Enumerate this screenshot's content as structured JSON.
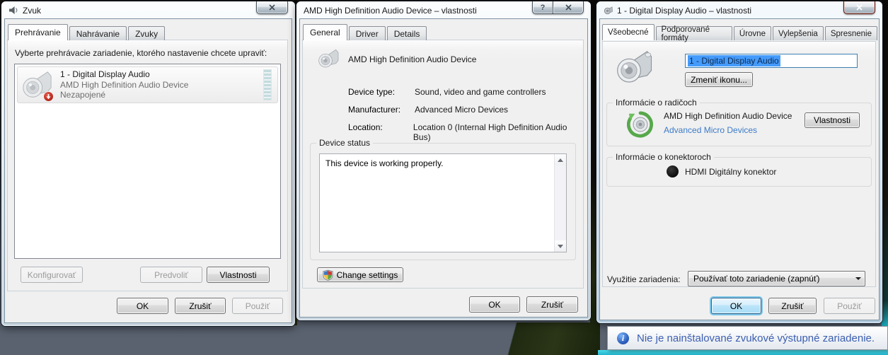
{
  "colors": {
    "selection_blue": "#459bfb",
    "link_blue": "#3c7bc7",
    "tooltip_text_blue": "#3c5fb0",
    "close_button_red": "#cf4731",
    "default_button_glow": "#3eafe4",
    "teal_strip": "#2fc3d6",
    "dialog_background": "#f0f0f0"
  },
  "sound_window": {
    "title": "Zvuk",
    "tabs": [
      "Prehrávanie",
      "Nahrávanie",
      "Zvuky"
    ],
    "instruction": "Vyberte prehrávacie zariadenie, ktorého nastavenie chcete upraviť:",
    "device": {
      "name": "1 - Digital Display Audio",
      "description": "AMD High Definition Audio Device",
      "status": "Nezapojené"
    },
    "configure_label": "Konfigurovať",
    "set_default_label": "Predvoliť",
    "properties_label": "Vlastnosti",
    "ok_label": "OK",
    "cancel_label": "Zrušiť",
    "apply_label": "Použiť"
  },
  "amd_window": {
    "title": "AMD High Definition Audio Device – vlastnosti",
    "help_glyph": "?",
    "tabs": [
      "General",
      "Driver",
      "Details"
    ],
    "device_name": "AMD High Definition Audio Device",
    "fields": [
      {
        "label": "Device type:",
        "value": "Sound, video and game controllers"
      },
      {
        "label": "Manufacturer:",
        "value": "Advanced Micro Devices"
      },
      {
        "label": "Location:",
        "value": "Location 0 (Internal High Definition Audio Bus)"
      }
    ],
    "status_group_label": "Device status",
    "status_text": "This device is working properly.",
    "change_settings_label": "Change settings",
    "ok_label": "OK",
    "cancel_label": "Zrušiť"
  },
  "display_window": {
    "title": "1 - Digital Display Audio – vlastnosti",
    "tabs": [
      "Všeobecné",
      "Podporované formáty",
      "Úrovne",
      "Vylepšenia",
      "Spresnenie"
    ],
    "device_name_value": "1 - Digital Display Audio",
    "change_icon_label": "Zmeniť ikonu...",
    "controller_group_label": "Informácie o radičoch",
    "controller_device": "AMD High Definition Audio Device",
    "controller_vendor_link": "Advanced Micro Devices",
    "controller_properties_label": "Vlastnosti",
    "connector_group_label": "Informácie o konektoroch",
    "connector_name": "HDMI Digitálny konektor",
    "device_usage_label": "Využitie zariadenia:",
    "device_usage_value": "Používať toto zariadenie (zapnúť)",
    "ok_label": "OK",
    "cancel_label": "Zrušiť",
    "apply_label": "Použiť"
  },
  "notification": {
    "text": "Nie je nainštalované zvukové výstupné zariadenie."
  }
}
